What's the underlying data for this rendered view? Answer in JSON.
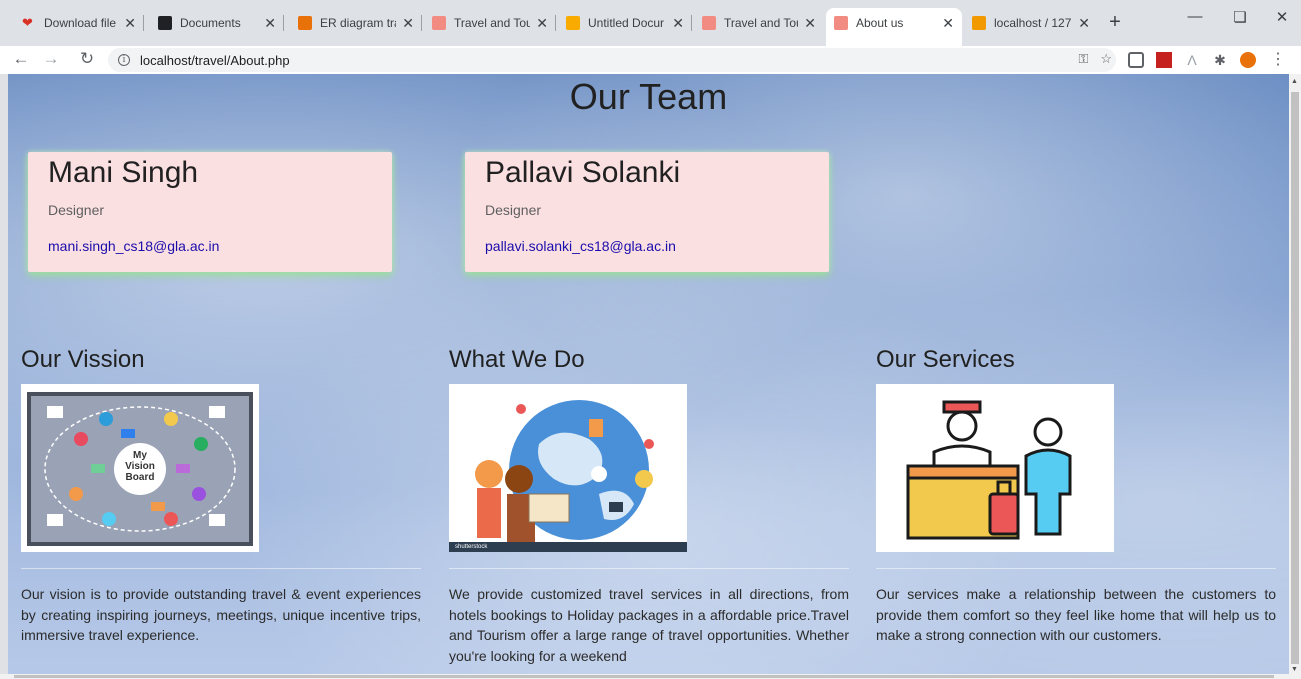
{
  "browser": {
    "tabs": [
      {
        "title": "Download file",
        "color": "#d93025"
      },
      {
        "title": "Documents",
        "color": "#202124"
      },
      {
        "title": "ER diagram tra",
        "color": "#e8710a"
      },
      {
        "title": "Travel and Tou",
        "color": "#f28b82"
      },
      {
        "title": "Untitled Docur",
        "color": "#f9ab00"
      },
      {
        "title": "Travel and Tou",
        "color": "#f28b82"
      },
      {
        "title": "About us",
        "color": "#f28b82"
      },
      {
        "title": "localhost / 127",
        "color": "#f29900"
      }
    ],
    "active_tab": 6,
    "url": "localhost/travel/About.php"
  },
  "page": {
    "team_title": "Our Team",
    "members": [
      {
        "name": "Mani Singh",
        "role": "Designer",
        "email": "mani.singh_cs18@gla.ac.in"
      },
      {
        "name": "Pallavi Solanki",
        "role": "Designer",
        "email": "pallavi.solanki_cs18@gla.ac.in"
      }
    ],
    "sections": [
      {
        "heading": "Our Vission",
        "image_label": "My Vision Board",
        "text": "Our vision is to provide outstanding travel & event experiences by creating inspiring journeys, meetings, unique incentive trips, immersive travel experience."
      },
      {
        "heading": "What We Do",
        "image_label": "shutterstock",
        "text": "We provide customized travel services in all directions, from hotels bookings to Holiday packages in a affordable price.Travel and Tourism offer a large range of travel opportunities. Whether you're looking for a weekend"
      },
      {
        "heading": "Our Services",
        "image_label": "",
        "text": "Our services make a relationship between the customers to provide them comfort so they feel like home that will help us to make a strong connection with our customers."
      }
    ]
  }
}
